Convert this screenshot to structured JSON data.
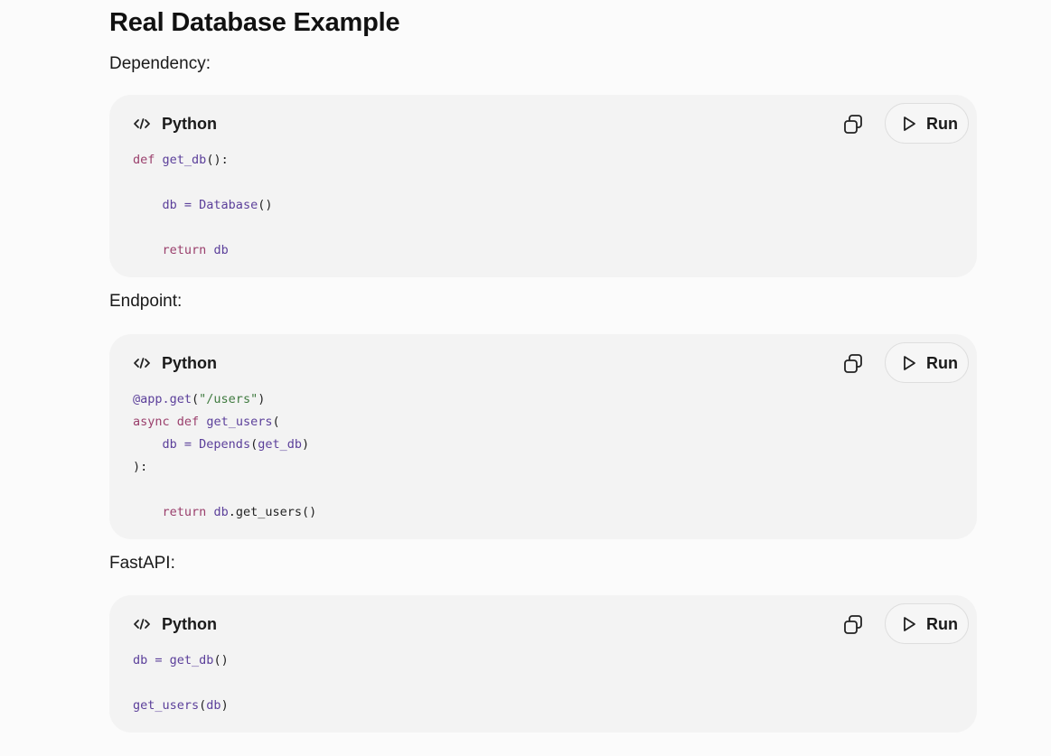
{
  "page": {
    "title": "Real Database Example"
  },
  "sections": [
    {
      "label": "Dependency:",
      "language": "Python",
      "copy_icon": "copy-icon",
      "run_label": "Run",
      "code_lines": [
        [
          {
            "t": "def",
            "k": "kw"
          },
          {
            "t": " ",
            "k": "punct"
          },
          {
            "t": "get_db",
            "k": "name"
          },
          {
            "t": "():",
            "k": "punct"
          }
        ],
        [],
        [
          {
            "t": "    ",
            "k": "punct"
          },
          {
            "t": "db",
            "k": "name"
          },
          {
            "t": " = ",
            "k": "name"
          },
          {
            "t": "Database",
            "k": "name"
          },
          {
            "t": "()",
            "k": "punct"
          }
        ],
        [],
        [
          {
            "t": "    ",
            "k": "punct"
          },
          {
            "t": "return",
            "k": "kw"
          },
          {
            "t": " ",
            "k": "punct"
          },
          {
            "t": "db",
            "k": "name"
          }
        ]
      ]
    },
    {
      "label": "Endpoint:",
      "language": "Python",
      "copy_icon": "copy-icon",
      "run_label": "Run",
      "code_lines": [
        [
          {
            "t": "@app.get",
            "k": "name"
          },
          {
            "t": "(",
            "k": "punct"
          },
          {
            "t": "\"/users\"",
            "k": "str"
          },
          {
            "t": ")",
            "k": "punct"
          }
        ],
        [
          {
            "t": "async",
            "k": "kw"
          },
          {
            "t": " ",
            "k": "punct"
          },
          {
            "t": "def",
            "k": "kw"
          },
          {
            "t": " ",
            "k": "punct"
          },
          {
            "t": "get_users",
            "k": "name"
          },
          {
            "t": "(",
            "k": "punct"
          }
        ],
        [
          {
            "t": "    ",
            "k": "punct"
          },
          {
            "t": "db",
            "k": "name"
          },
          {
            "t": " = ",
            "k": "name"
          },
          {
            "t": "Depends",
            "k": "name"
          },
          {
            "t": "(",
            "k": "punct"
          },
          {
            "t": "get_db",
            "k": "name"
          },
          {
            "t": ")",
            "k": "punct"
          }
        ],
        [
          {
            "t": "):",
            "k": "punct"
          }
        ],
        [],
        [
          {
            "t": "    ",
            "k": "punct"
          },
          {
            "t": "return",
            "k": "kw"
          },
          {
            "t": " ",
            "k": "punct"
          },
          {
            "t": "db",
            "k": "name"
          },
          {
            "t": ".get_users()",
            "k": "punct"
          }
        ]
      ]
    },
    {
      "label": "FastAPI:",
      "language": "Python",
      "copy_icon": "copy-icon",
      "run_label": "Run",
      "code_lines": [
        [
          {
            "t": "db",
            "k": "name"
          },
          {
            "t": " = ",
            "k": "name"
          },
          {
            "t": "get_db",
            "k": "name"
          },
          {
            "t": "()",
            "k": "punct"
          }
        ],
        [],
        [
          {
            "t": "get_users",
            "k": "name"
          },
          {
            "t": "(",
            "k": "punct"
          },
          {
            "t": "db",
            "k": "name"
          },
          {
            "t": ")",
            "k": "punct"
          }
        ]
      ]
    }
  ],
  "colors": {
    "background": "#fbfbfb",
    "card": "#f3f3f3",
    "keyword": "#9a3f6c",
    "identifier": "#5b3f9a",
    "string": "#3f7a3f"
  }
}
